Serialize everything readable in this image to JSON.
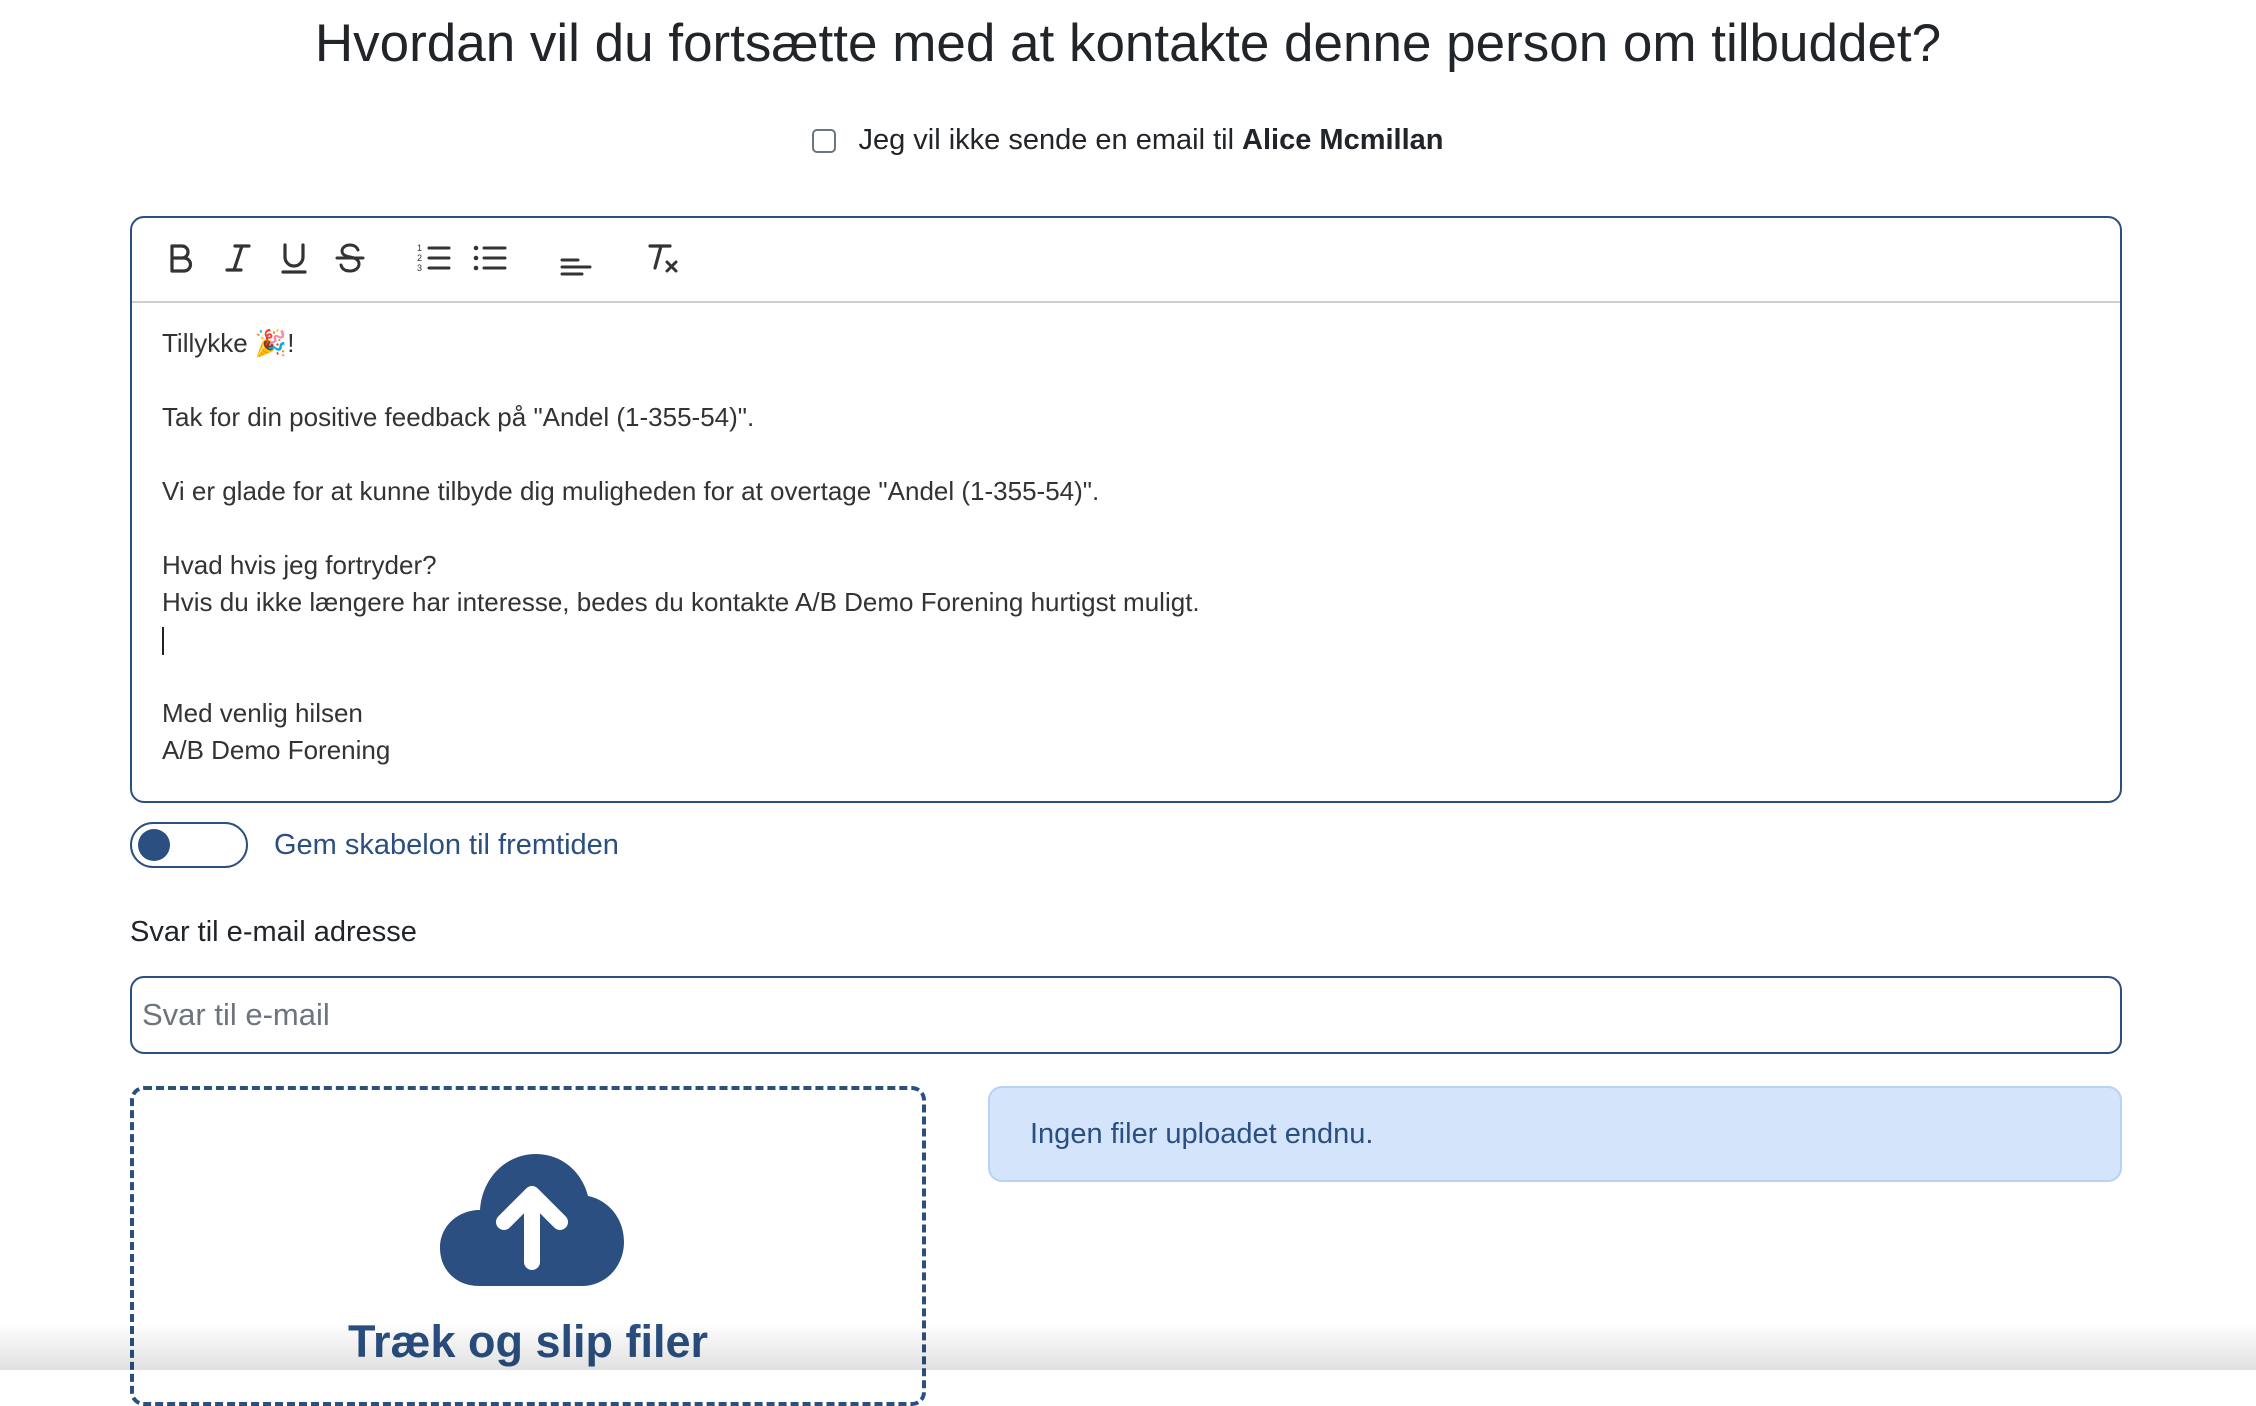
{
  "heading": "Hvordan vil du fortsætte med at kontakte denne person om tilbuddet?",
  "optout": {
    "label": "Jeg vil ikke sende en email til",
    "name": "Alice Mcmillan",
    "checked": false
  },
  "toolbar": {
    "buttons": [
      "bold-icon",
      "italic-icon",
      "underline-icon",
      "strikethrough-icon",
      "ordered-list-icon",
      "bullet-list-icon",
      "align-icon",
      "clear-format-icon"
    ]
  },
  "editor": {
    "lines": [
      "Tillykke 🎉!",
      "",
      "Tak for din positive feedback på \"Andel (1-355-54)\".",
      "",
      "Vi er glade for at kunne tilbyde dig muligheden for at overtage \"Andel (1-355-54)\".",
      "",
      "Hvad hvis jeg fortryder?",
      "Hvis du ikke længere har interesse, bedes du kontakte A/B Demo Forening hurtigst muligt.",
      "",
      "",
      "Med venlig hilsen",
      "A/B Demo Forening"
    ]
  },
  "template_toggle": {
    "label": "Gem skabelon til fremtiden",
    "on": false
  },
  "reply_to": {
    "label": "Svar til e-mail adresse",
    "placeholder": "Svar til e-mail",
    "value": ""
  },
  "upload": {
    "dropzone_label": "Træk og slip filer",
    "empty_message": "Ingen filer uploadet endnu."
  },
  "colors": {
    "primary": "#2a4f80",
    "info_bg": "#d3e4fb",
    "text": "#212529"
  }
}
